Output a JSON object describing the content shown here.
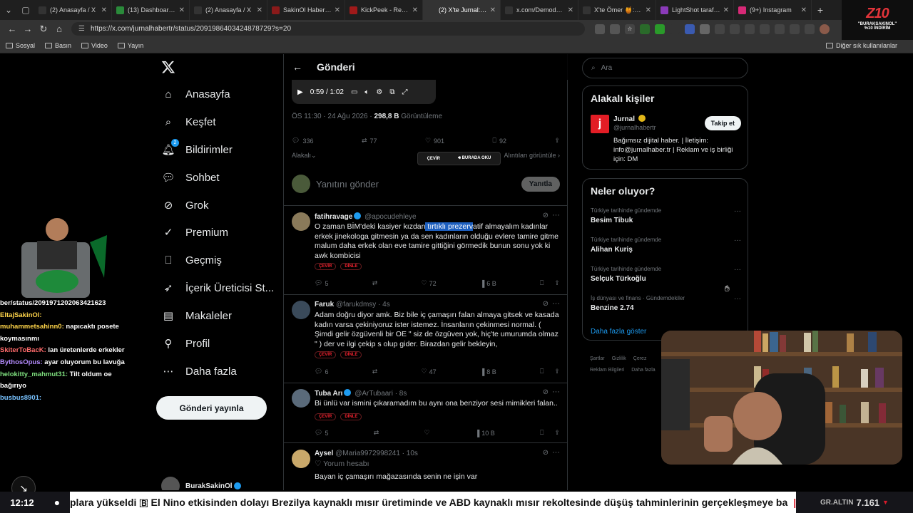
{
  "browser": {
    "tabs": [
      {
        "title": "(2) Anasayfa / X",
        "icon": "x-icon",
        "color": "#333"
      },
      {
        "title": "(13) Dashboard / St",
        "icon": "dashboard-icon",
        "color": "#2a8a3a"
      },
      {
        "title": "(2) Anasayfa / X",
        "icon": "x-icon",
        "color": "#333"
      },
      {
        "title": "SakinOl Haber Merk",
        "icon": "news-icon",
        "color": "#8a1a1a"
      },
      {
        "title": "KickPeek - Real-tim",
        "icon": "kickpeek-icon",
        "color": "#a01a1a"
      },
      {
        "title": "(2) X'te Jurnal: \"Bir v",
        "icon": "x-icon",
        "color": "#333",
        "active": true
      },
      {
        "title": "x.com/DemodeArsiv",
        "icon": "x-icon",
        "color": "#333"
      },
      {
        "title": "X'te Ömer 🍯: \"48 s",
        "icon": "x-icon",
        "color": "#333"
      },
      {
        "title": "LightShot tarafında",
        "icon": "lightshot-icon",
        "color": "#8a3ab9"
      },
      {
        "title": "(9+) Instagram",
        "icon": "instagram-icon",
        "color": "#d62976"
      }
    ],
    "url": "https://x.com/jurnalhabertr/status/2091986403424878729?s=20",
    "bookmarks": [
      "Sosyal",
      "Basın",
      "Video",
      "Yayın"
    ],
    "other_bookmarks": "Diğer sık kullanılanlar"
  },
  "sale_overlay": {
    "logo": "Z10",
    "code": "\"BURAKSAKINOL\"",
    "discount": "%10 İNDİRİM"
  },
  "nav": {
    "items": [
      {
        "label": "Anasayfa",
        "icon": "home-icon"
      },
      {
        "label": "Keşfet",
        "icon": "search-icon"
      },
      {
        "label": "Bildirimler",
        "icon": "bell-icon",
        "badge": "2"
      },
      {
        "label": "Sohbet",
        "icon": "chat-icon"
      },
      {
        "label": "Grok",
        "icon": "grok-icon"
      },
      {
        "label": "Premium",
        "icon": "premium-icon"
      },
      {
        "label": "Geçmiş",
        "icon": "bookmark-icon"
      },
      {
        "label": "İçerik Üreticisi St...",
        "icon": "rocket-icon"
      },
      {
        "label": "Makaleler",
        "icon": "article-icon"
      },
      {
        "label": "Profil",
        "icon": "profile-icon"
      },
      {
        "label": "Daha fazla",
        "icon": "more-icon"
      }
    ],
    "post_button": "Gönderi yayınla",
    "account_name": "BurakSakinOl"
  },
  "main": {
    "header_title": "Gönderi",
    "video_time": "0:59 / 1:02",
    "meta_time": "ÖS 11:30 · 24 Ağu 2026 · ",
    "meta_views": "298,8 B",
    "meta_views_label": "Görüntüleme",
    "stats": {
      "replies": "336",
      "reposts": "77",
      "likes": "901",
      "bookmarks": "92"
    },
    "sort_left": "Alakalı",
    "sort_right": "Alıntıları görüntüle",
    "reply_placeholder": "Yanıtını gönder",
    "reply_button": "Yanıtla",
    "translate_popup": {
      "left": "ÇEVİR",
      "right": "BURADA OKU"
    },
    "tag_translate": "ÇEVİR",
    "tag_listen": "DİNLE",
    "posts": [
      {
        "name": "fatihravage",
        "handle": "@apocudehleye",
        "time": "",
        "text_pre": "O zaman BİM'deki kasiyer kızdan",
        "text_hl": " tırtıklı prezerv",
        "text_post": "atif almayalım kadınlar erkek jinekologa gitmesin ya da sen kadınların olduğu evlere tamire gitme malum daha erkek olan eve tamire gittiğini görmedik bunun sonu yok ki awk kombicisi",
        "replies": "5",
        "likes": "72",
        "views": "6 B"
      },
      {
        "name": "Faruk",
        "handle": "@farukdmsy · 4s",
        "text": "Adam doğru diyor amk. Biz bile iç çamaşırı falan almaya gitsek ve kasada kadın varsa çekiniyoruz ister istemez. İnsanların çekinmesi normal. ( Şimdi gelir özgüvenli bir OE \" siz de özgüven yok, hiç'te umurumda olmaz \" ) der ve ilgi çekip s olup gider. Birazdan gelir bekleyin,",
        "replies": "6",
        "likes": "47",
        "views": "8 B"
      },
      {
        "name": "Tuba Arı",
        "handle": "@ArTubaari · 8s",
        "text": "Bi ünlü var ismini çıkaramadım bu aynı ona benziyor sesi mimikleri falan..",
        "replies": "5",
        "likes": "",
        "views": "10 B"
      },
      {
        "name": "Aysel",
        "handle": "@Maria9972998241 · 10s",
        "sub": "Yorum hesabı",
        "text": "Bayan iç çamaşırı mağazasında senin ne işin var"
      }
    ]
  },
  "right": {
    "search_placeholder": "Ara",
    "people_title": "Alakalı kişiler",
    "person": {
      "name": "Jurnal",
      "handle": "@jurnalhabertr",
      "follow": "Takip et",
      "bio": "Bağımsız dijital haber. | İletişim: info@jurnalhaber.tr | Reklam ve iş birliği için: DM",
      "avatar_letter": "j"
    },
    "trends_title": "Neler oluyor?",
    "trends": [
      {
        "cat": "Türkiye tarihinde gündemde",
        "name": "Besim Tibuk"
      },
      {
        "cat": "Türkiye tarihinde gündemde",
        "name": "Alihan Kuriş"
      },
      {
        "cat": "Türkiye tarihinde gündemde",
        "name": "Selçuk Türkoğlu"
      },
      {
        "cat": "İş dünyası ve finans · Gündemdekiler",
        "name": "Benzine 2.74"
      }
    ],
    "show_more": "Daha fazla göster",
    "footer": [
      "Şartlar",
      "Gizlilik",
      "Çerez",
      "Reklam Bilgileri",
      "Daha fazla"
    ]
  },
  "chat": {
    "url_line": "ber/status/2091971202063421623",
    "messages": [
      {
        "user": "EltajSakinOl:",
        "text": "",
        "cls": "u"
      },
      {
        "user": "muhammetsahinn0:",
        "text": "napıcaktı posete koymasınmı",
        "cls": "u"
      },
      {
        "user": "SkiterToBacK:",
        "text": "lan üretenlerde erkekler",
        "cls": "u2"
      },
      {
        "user": "BythosOpus:",
        "text": "ayar oluyorum bu lavuğa",
        "cls": "u3"
      },
      {
        "user": "helokitty_mahmut31:",
        "text": "Tilt oldum oe bağırıyo",
        "cls": "u4"
      },
      {
        "user": "busbus8901:",
        "text": "",
        "cls": "u5"
      }
    ]
  },
  "ticker": {
    "time": "12:12",
    "news": "plara yükseldi 🇧 El Nino etkisinden dolayı Brezilya kaynaklı mısır üretiminde ve ABD kaynaklı mısır rekoltesinde düşüş tahminlerinin gerçekleşmeye ba",
    "gold_label": "GR.ALTIN",
    "gold_value": "7.161"
  }
}
